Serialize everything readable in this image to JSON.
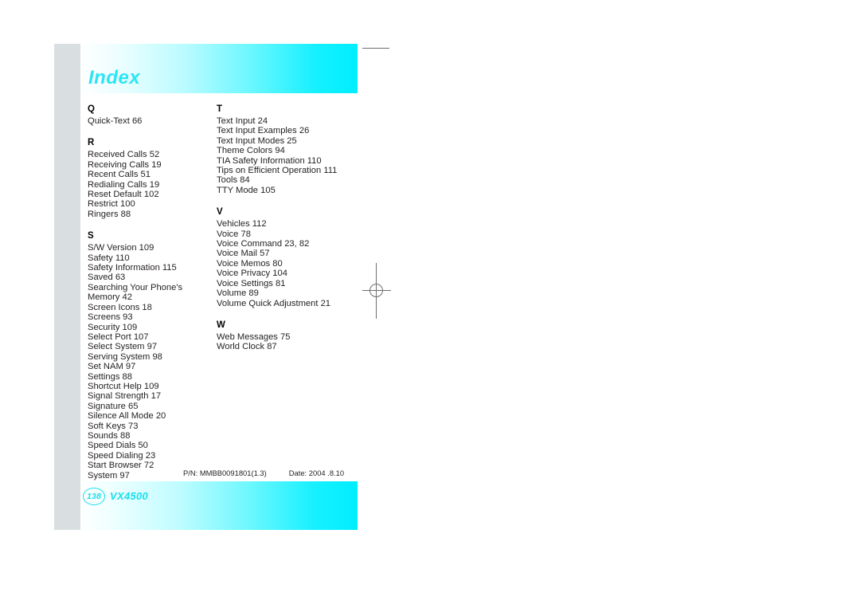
{
  "page": {
    "title": "Index",
    "model": "VX4500",
    "page_number": "138",
    "background_color": "#ffffff",
    "accent_color": "#00eeff",
    "title_color": "#2ae6f5"
  },
  "imprint": {
    "part_number": "P/N: MMBB0091801(1.3)",
    "date": "Date: 2004 .8.10"
  },
  "index": {
    "left_column": [
      {
        "letter": "Q",
        "entries": [
          "Quick-Text 66"
        ]
      },
      {
        "letter": "R",
        "entries": [
          "Received Calls 52",
          "Receiving Calls 19",
          "Recent Calls 51",
          "Redialing Calls 19",
          "Reset Default 102",
          "Restrict 100",
          "Ringers 88"
        ]
      },
      {
        "letter": "S",
        "entries": [
          "S/W Version 109",
          "Safety 110",
          "Safety Information 115",
          "Saved 63",
          "Searching Your Phone's\nMemory 42",
          "Screen Icons 18",
          "Screens 93",
          "Security 109",
          "Select Port 107",
          "Select System 97",
          "Serving System 98",
          "Set NAM 97",
          "Settings 88",
          "Shortcut Help 109",
          "Signal Strength 17",
          "Signature 65",
          "Silence All Mode 20",
          "Soft Keys 73",
          "Sounds 88",
          "Speed Dials 50",
          "Speed Dialing 23",
          "Start Browser 72",
          "System 97"
        ]
      }
    ],
    "right_column": [
      {
        "letter": "T",
        "entries": [
          "Text Input 24",
          "Text Input Examples 26",
          "Text Input Modes 25",
          "Theme Colors 94",
          "TIA Safety Information 110",
          "Tips on Efficient Operation 111",
          "Tools 84",
          "TTY Mode 105"
        ]
      },
      {
        "letter": "V",
        "entries": [
          "Vehicles 112",
          "Voice 78",
          "Voice Command 23, 82",
          "Voice Mail 57",
          "Voice Memos 80",
          "Voice Privacy 104",
          "Voice Settings 81",
          "Volume 89",
          "Volume Quick Adjustment 21"
        ]
      },
      {
        "letter": "W",
        "entries": [
          "Web Messages 75",
          "World Clock 87"
        ]
      }
    ]
  }
}
